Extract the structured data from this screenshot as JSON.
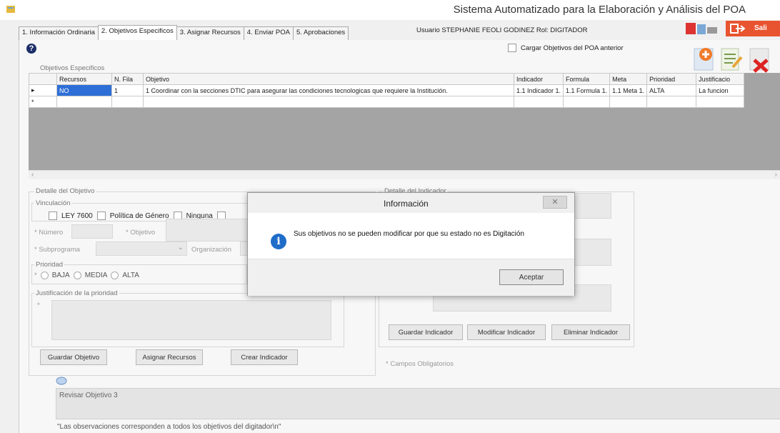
{
  "window": {
    "title": "Sistema Automatizado para la Elaboración y Análisis del POA",
    "salir_label": "Sali"
  },
  "tabs": [
    {
      "label": "1. Información Ordinaria"
    },
    {
      "label": "2. Objetivos Especificos"
    },
    {
      "label": "3. Asignar Recursos"
    },
    {
      "label": "4. Enviar POA"
    },
    {
      "label": "5. Aprobaciones"
    }
  ],
  "user_line": "Usuario STEPHANIE FEOLI GODINEZ  Rol: DIGITADOR",
  "load_previous_label": "Cargar Objetivos del POA anterior",
  "objectives_group_title": "Objetivos Especificos",
  "grid": {
    "columns": [
      "Recursos",
      "N. Fila",
      "Objetivo",
      "Indicador",
      "Formula",
      "Meta",
      "Prioridad",
      "Justificacio"
    ],
    "rows": [
      [
        "NO",
        "1",
        "1 Coordinar con la secciones DTIC para asegurar las condiciones tecnologicas que requiere la Institución.",
        "1.1 Indicador 1.",
        "1.1 Formula 1.",
        "1.1 Meta 1.",
        "ALTA",
        "La funcion"
      ]
    ]
  },
  "detalle_objetivo": {
    "title": "Detalle del Objetivo",
    "vinculacion_title": "Vinculación",
    "vinc_options": [
      "LEY 7600",
      "Política de Género",
      "Ninguna"
    ],
    "numero_label": "* Número",
    "objetivo_label": "* Objetivo",
    "subprograma_label": "* Subprograma",
    "organizacion_label": "Organización",
    "prioridad_title": "Prioridad",
    "prioridad_options": [
      "BAJA",
      "MEDIA",
      "ALTA"
    ],
    "justificacion_title": "Justificación de la prioridad",
    "buttons": [
      "Guardar Objetivo",
      "Asignar Recursos",
      "Crear Indicador"
    ]
  },
  "detalle_indicador": {
    "title": "Detalle del Indicador",
    "buttons": [
      "Guardar Indicador",
      "Modificar Indicador",
      "Eliminar Indicador"
    ]
  },
  "campos_obligatorios": "* Campos Obligatorios",
  "observaciones": {
    "value": "Revisar Objetivo 3",
    "note": "\"Las observaciones corresponden a todos los objetivos del digitador\\n\""
  },
  "dialog": {
    "title": "Información",
    "message": "Sus objetivos no se pueden modificar por que su estado no es Digitación",
    "ok_label": "Aceptar",
    "close_glyph": "✕"
  }
}
